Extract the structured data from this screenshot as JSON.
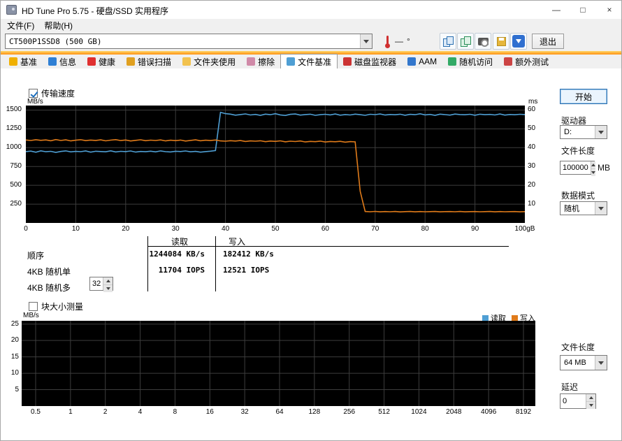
{
  "window": {
    "title": "HD Tune Pro 5.75 - 硬盘/SSD 实用程序",
    "controls": {
      "minimize": "—",
      "maximize": "□",
      "close": "×"
    }
  },
  "menu": {
    "file": "文件(F)",
    "help": "帮助(H)"
  },
  "toolbar": {
    "drive_select": "CT500P1SSD8 (500 GB)",
    "temp_value": "—",
    "temp_unit": "°",
    "exit_label": "退出"
  },
  "tabs": [
    {
      "name": "benchmark",
      "label": "基准",
      "selected": false,
      "icon_color": "#f0b000"
    },
    {
      "name": "info",
      "label": "信息",
      "selected": false,
      "icon_color": "#2f7fd4"
    },
    {
      "name": "health",
      "label": "健康",
      "selected": false,
      "icon_color": "#e03030"
    },
    {
      "name": "error-scan",
      "label": "错误扫描",
      "selected": false,
      "icon_color": "#e0a020"
    },
    {
      "name": "folder-usage",
      "label": "文件夹使用",
      "selected": false,
      "icon_color": "#f2c24e"
    },
    {
      "name": "erase",
      "label": "擦除",
      "selected": false,
      "icon_color": "#d08aa8"
    },
    {
      "name": "file-benchmark",
      "label": "文件基准",
      "selected": true,
      "icon_color": "#4f9fd4"
    },
    {
      "name": "disk-monitor",
      "label": "磁盘监视器",
      "selected": false,
      "icon_color": "#cc3333"
    },
    {
      "name": "aam",
      "label": "AAM",
      "selected": false,
      "icon_color": "#3377cc"
    },
    {
      "name": "random-access",
      "label": "随机访问",
      "selected": false,
      "icon_color": "#33aa66"
    },
    {
      "name": "extra-tests",
      "label": "额外测试",
      "selected": false,
      "icon_color": "#cc4444"
    }
  ],
  "main": {
    "transfer_speed_label": "传输速度",
    "block_size_label": "块大小测量",
    "results": {
      "col_read": "读取",
      "col_write": "写入",
      "rows": [
        {
          "label": "顺序",
          "read": "1244084 KB/s",
          "write": "182412 KB/s"
        },
        {
          "label": "4KB 随机单",
          "read": "11704 IOPS",
          "write": "12521 IOPS"
        },
        {
          "label": "4KB 随机多",
          "read": "",
          "write": "",
          "spin_value": "32"
        }
      ]
    },
    "legend": {
      "read_label": "读取",
      "write_label": "写入",
      "read_color": "#4f9fd4",
      "write_color": "#e07b1a"
    }
  },
  "sidebar": {
    "start_label": "开始",
    "drive_label": "驱动器",
    "drive_value": "D:",
    "file_length_label": "文件长度",
    "file_length_value": "100000",
    "file_length_unit": "MB",
    "data_mode_label": "数据模式",
    "data_mode_value": "随机",
    "block_file_length_label": "文件长度",
    "block_file_length_value": "64 MB",
    "delay_label": "延迟",
    "delay_value": "0"
  },
  "chart_data": [
    {
      "type": "line",
      "title": "传输速度",
      "ylabel_left": "MB/s",
      "ylabel_right": "ms",
      "xlim": [
        0,
        100
      ],
      "ylim_left": [
        0,
        1560
      ],
      "ylim_right": [
        0,
        62.4
      ],
      "grid_color": "#3d3d3d",
      "x_ticks": [
        0,
        10,
        20,
        30,
        40,
        50,
        60,
        70,
        80,
        90,
        100
      ],
      "x_tick_labels": [
        "0",
        "10",
        "20",
        "30",
        "40",
        "50",
        "60",
        "70",
        "80",
        "90",
        "100gB"
      ],
      "y_left_ticks": [
        250,
        500,
        750,
        1000,
        1250,
        1500
      ],
      "y_right_ticks": [
        10,
        20,
        30,
        40,
        50,
        60
      ],
      "x_start": 0,
      "x_step": 1,
      "series": [
        {
          "name": "读取",
          "color": "#4f9fd4",
          "values": [
            948,
            955,
            940,
            958,
            946,
            952,
            938,
            950,
            957,
            944,
            951,
            947,
            956,
            941,
            953,
            949,
            945,
            958,
            943,
            952,
            948,
            956,
            942,
            950,
            946,
            954,
            944,
            957,
            947,
            943,
            953,
            949,
            956,
            945,
            951,
            941,
            948,
            954,
            962,
            1470,
            1452,
            1446,
            1432,
            1440,
            1449,
            1435,
            1442,
            1430,
            1446,
            1438,
            1451,
            1436,
            1428,
            1443,
            1448,
            1433,
            1440,
            1445,
            1430,
            1438,
            1444,
            1436,
            1448,
            1432,
            1440,
            1435,
            1446,
            1438,
            1430,
            1444,
            1439,
            1448,
            1434,
            1441,
            1437,
            1445,
            1431,
            1443,
            1438,
            1450,
            1436,
            1442,
            1430,
            1446,
            1439,
            1433,
            1447,
            1440,
            1437,
            1444,
            1431,
            1445,
            1438,
            1442,
            1435,
            1448,
            1433,
            1441,
            1437,
            1444,
            1440
          ]
        },
        {
          "name": "写入",
          "color": "#e07b1a",
          "values": [
            1102,
            1096,
            1106,
            1098,
            1103,
            1092,
            1108,
            1096,
            1104,
            1090,
            1099,
            1106,
            1094,
            1101,
            1097,
            1104,
            1091,
            1100,
            1107,
            1095,
            1102,
            1089,
            1098,
            1105,
            1093,
            1100,
            1096,
            1103,
            1090,
            1099,
            1094,
            1101,
            1088,
            1097,
            1104,
            1092,
            1099,
            1095,
            1102,
            1090,
            1086,
            1093,
            1088,
            1095,
            1083,
            1090,
            1086,
            1092,
            1080,
            1088,
            1084,
            1091,
            1078,
            1086,
            1082,
            1089,
            1076,
            1084,
            1080,
            1087,
            1075,
            1083,
            1079,
            1085,
            1073,
            1081,
            1077,
            420,
            152,
            149,
            153,
            148,
            151,
            149,
            152,
            147,
            150,
            152,
            148,
            151,
            149,
            150,
            152,
            148,
            150,
            151,
            149,
            152,
            148,
            150,
            151,
            149,
            150,
            152,
            148,
            151,
            149,
            150,
            151,
            148,
            150
          ]
        }
      ]
    },
    {
      "type": "line",
      "title": "块大小测量",
      "ylabel": "MB/s",
      "ylim": [
        0,
        26
      ],
      "grid_color": "#3d3d3d",
      "y_ticks": [
        5,
        10,
        15,
        20,
        25
      ],
      "x_tick_labels": [
        "0.5",
        "1",
        "2",
        "4",
        "8",
        "16",
        "32",
        "64",
        "128",
        "256",
        "512",
        "1024",
        "2048",
        "4096",
        "8192"
      ],
      "series": []
    }
  ]
}
